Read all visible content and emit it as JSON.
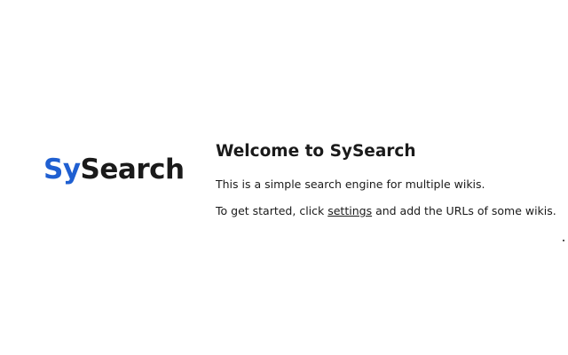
{
  "logo": {
    "part1": "Sy",
    "part2": "Search",
    "accent_color": "#1f5fd1"
  },
  "main": {
    "title": "Welcome to SySearch",
    "description": "This is a simple search engine for multiple wikis.",
    "instruction_prefix": "To get started, click ",
    "settings_link": "settings",
    "instruction_suffix": " and add the URLs of some wikis."
  }
}
